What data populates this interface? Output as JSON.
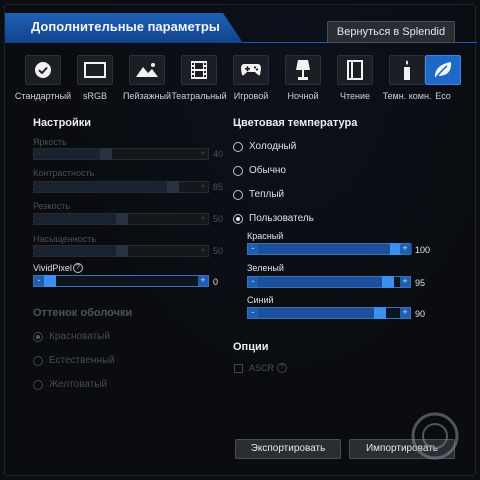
{
  "window": {
    "title": "Дополнительные параметры",
    "back_button": "Вернуться в Splendid"
  },
  "modes": [
    {
      "label": "Стандартный",
      "icon": "check-icon"
    },
    {
      "label": "sRGB",
      "icon": "display-icon"
    },
    {
      "label": "Пейзажный",
      "icon": "landscape-icon"
    },
    {
      "label": "Театральный",
      "icon": "film-icon"
    },
    {
      "label": "Игровой",
      "icon": "gamepad-icon"
    },
    {
      "label": "Ночной",
      "icon": "lamp-icon"
    },
    {
      "label": "Чтение",
      "icon": "book-icon"
    },
    {
      "label": "Темн. комн.",
      "icon": "candle-icon"
    },
    {
      "label": "Eco",
      "icon": "leaf-icon",
      "active": true
    }
  ],
  "settings": {
    "title": "Настройки",
    "sliders": [
      {
        "label": "Яркость",
        "value": "40",
        "enabled": false
      },
      {
        "label": "Контрастность",
        "value": "85",
        "enabled": false
      },
      {
        "label": "Резкость",
        "value": "50",
        "enabled": false
      },
      {
        "label": "Насыщенность",
        "value": "50",
        "enabled": false
      },
      {
        "label": "VividPixel",
        "value": "0",
        "enabled": true
      }
    ]
  },
  "skin_tone": {
    "title": "Оттенок оболочки",
    "options": [
      "Красноватый",
      "Естественный",
      "Желтоватый"
    ],
    "selected": 0
  },
  "color_temp": {
    "title": "Цветовая температура",
    "options": [
      "Холодный",
      "Обычно",
      "Теплый",
      "Пользователь"
    ],
    "selected": 3,
    "channels": [
      {
        "label": "Красный",
        "value": "100"
      },
      {
        "label": "Зеленый",
        "value": "95"
      },
      {
        "label": "Синий",
        "value": "90"
      }
    ]
  },
  "options": {
    "title": "Опции",
    "asc_label": "ASCR"
  },
  "footer": {
    "export": "Экспортировать",
    "import": "Импортировать"
  },
  "colors": {
    "accent": "#1e68c8",
    "background": "#0a0c10"
  }
}
